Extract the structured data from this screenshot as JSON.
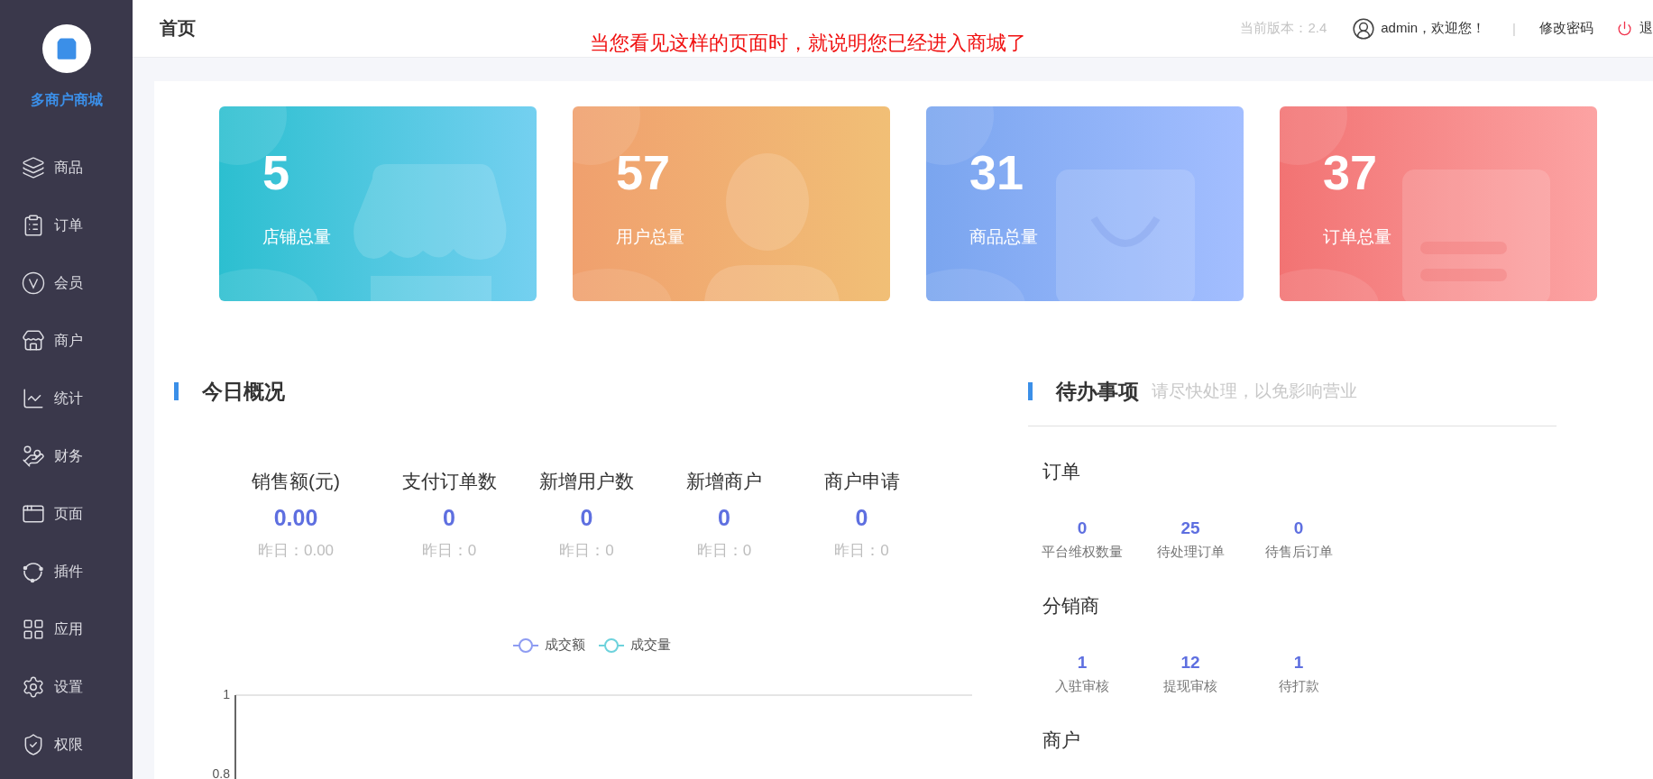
{
  "sidebar": {
    "brand": "多商户商城",
    "items": [
      {
        "label": "商品",
        "kind": "layers"
      },
      {
        "label": "订单",
        "kind": "clipboard"
      },
      {
        "label": "会员",
        "kind": "member"
      },
      {
        "label": "商户",
        "kind": "store"
      },
      {
        "label": "统计",
        "kind": "chart"
      },
      {
        "label": "财务",
        "kind": "finance"
      },
      {
        "label": "页面",
        "kind": "page"
      },
      {
        "label": "插件",
        "kind": "plugin"
      },
      {
        "label": "应用",
        "kind": "apps"
      },
      {
        "label": "设置",
        "kind": "settings"
      },
      {
        "label": "权限",
        "kind": "shield"
      }
    ]
  },
  "header": {
    "title": "首页",
    "notice": "当您看见这样的页面时，就说明您已经进入商城了",
    "version": "当前版本：2.4",
    "greeting": "admin，欢迎您！",
    "separator": "|",
    "change_password": "修改密码",
    "logout": "退"
  },
  "cards": [
    {
      "value": "5",
      "label": "店铺总量",
      "kind": "shop"
    },
    {
      "value": "57",
      "label": "用户总量",
      "kind": "user"
    },
    {
      "value": "31",
      "label": "商品总量",
      "kind": "goods"
    },
    {
      "value": "37",
      "label": "订单总量",
      "kind": "order"
    }
  ],
  "overview": {
    "title": "今日概况",
    "stats": [
      {
        "label": "销售额(元)",
        "value": "0.00",
        "yesterday": "昨日：0.00"
      },
      {
        "label": "支付订单数",
        "value": "0",
        "yesterday": "昨日：0"
      },
      {
        "label": "新增用户数",
        "value": "0",
        "yesterday": "昨日：0"
      },
      {
        "label": "新增商户",
        "value": "0",
        "yesterday": "昨日：0"
      },
      {
        "label": "商户申请",
        "value": "0",
        "yesterday": "昨日：0"
      }
    ],
    "chart": {
      "legend": [
        {
          "name": "成交额",
          "color": "#8e9cf2"
        },
        {
          "name": "成交量",
          "color": "#6dd2dc"
        }
      ],
      "y_ticks": [
        "1",
        "0.8"
      ]
    }
  },
  "todo": {
    "title": "待办事项",
    "subtitle": "请尽快处理，以免影响营业",
    "groups": [
      {
        "title": "订单",
        "items": [
          {
            "value": "0",
            "label": "平台维权数量"
          },
          {
            "value": "25",
            "label": "待处理订单"
          },
          {
            "value": "0",
            "label": "待售后订单"
          }
        ]
      },
      {
        "title": "分销商",
        "items": [
          {
            "value": "1",
            "label": "入驻审核"
          },
          {
            "value": "12",
            "label": "提现审核"
          },
          {
            "value": "1",
            "label": "待打款"
          }
        ]
      },
      {
        "title": "商户"
      }
    ]
  }
}
